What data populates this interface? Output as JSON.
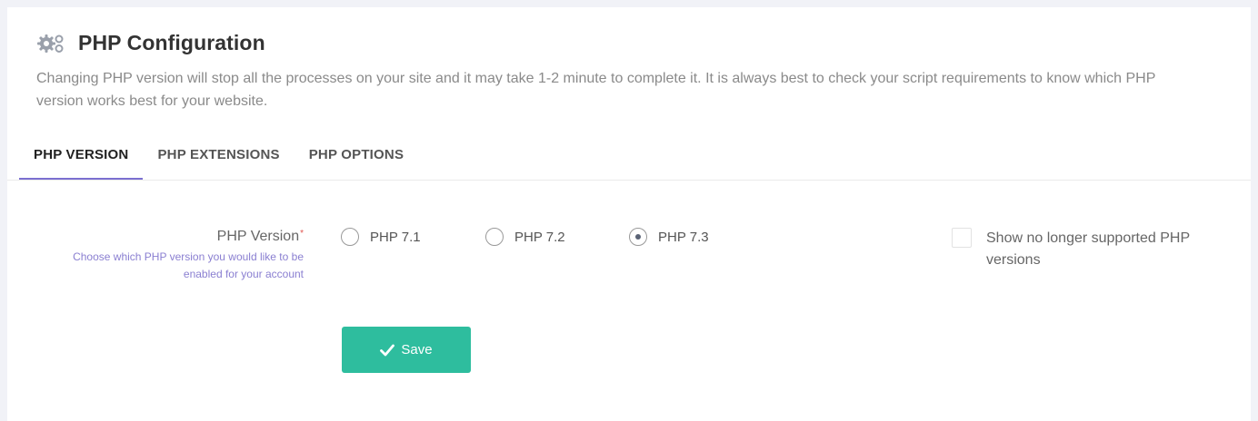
{
  "header": {
    "title": "PHP Configuration",
    "icon": "gears-icon",
    "description": "Changing PHP version will stop all the processes on your site and it may take 1-2 minute to complete it. It is always best to check your script requirements to know which PHP version works best for your website."
  },
  "tabs": [
    {
      "label": "PHP VERSION",
      "active": true
    },
    {
      "label": "PHP EXTENSIONS",
      "active": false
    },
    {
      "label": "PHP OPTIONS",
      "active": false
    }
  ],
  "form": {
    "label": "PHP Version",
    "required_mark": "*",
    "help": "Choose which PHP version you would like to be enabled for your account",
    "options": [
      {
        "label": "PHP 7.1",
        "selected": false
      },
      {
        "label": "PHP 7.2",
        "selected": false
      },
      {
        "label": "PHP 7.3",
        "selected": true
      }
    ],
    "show_unsupported": {
      "label": "Show no longer supported PHP versions",
      "checked": false
    }
  },
  "actions": {
    "save_label": "Save",
    "save_icon": "check-icon"
  },
  "colors": {
    "accent": "#2ebd9e",
    "tab_underline": "#7b6fd0",
    "help_text": "#8a7fd1",
    "required": "#e0554f"
  }
}
